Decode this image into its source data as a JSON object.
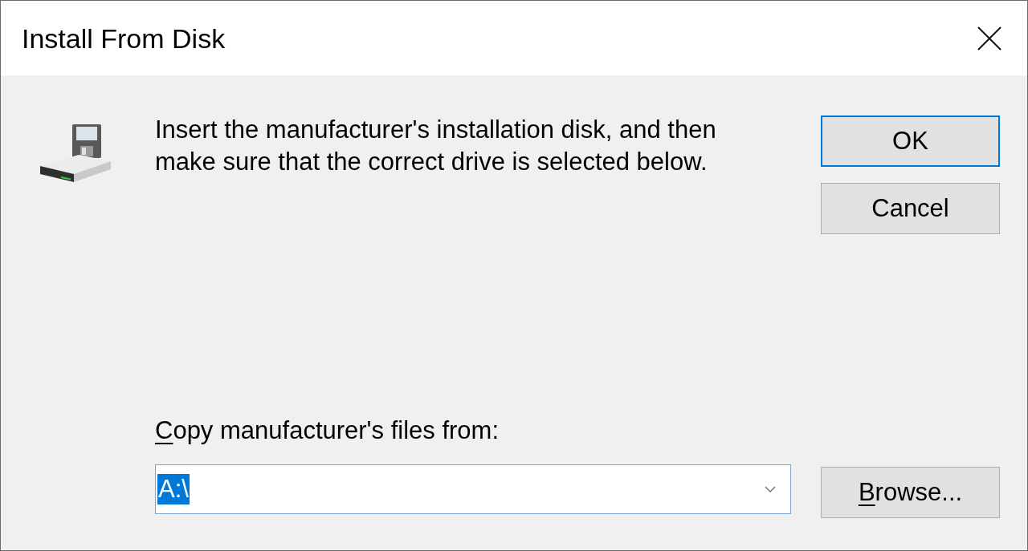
{
  "window": {
    "title": "Install From Disk"
  },
  "message": "Insert the manufacturer's installation disk, and then make sure that the correct drive is selected below.",
  "buttons": [
    {
      "label": "OK",
      "focused": true
    },
    {
      "label": "Cancel",
      "focused": false
    }
  ],
  "source": {
    "label": [
      {
        "text": "C",
        "underlined": true
      },
      {
        "text": "opy manufacturer's files from:",
        "underlined": false
      }
    ],
    "field": {
      "value": "A:\\",
      "selected": true
    },
    "browse": {
      "label": [
        {
          "text": "B",
          "underlined": true
        },
        {
          "text": "rowse...",
          "underlined": false
        }
      ]
    }
  }
}
